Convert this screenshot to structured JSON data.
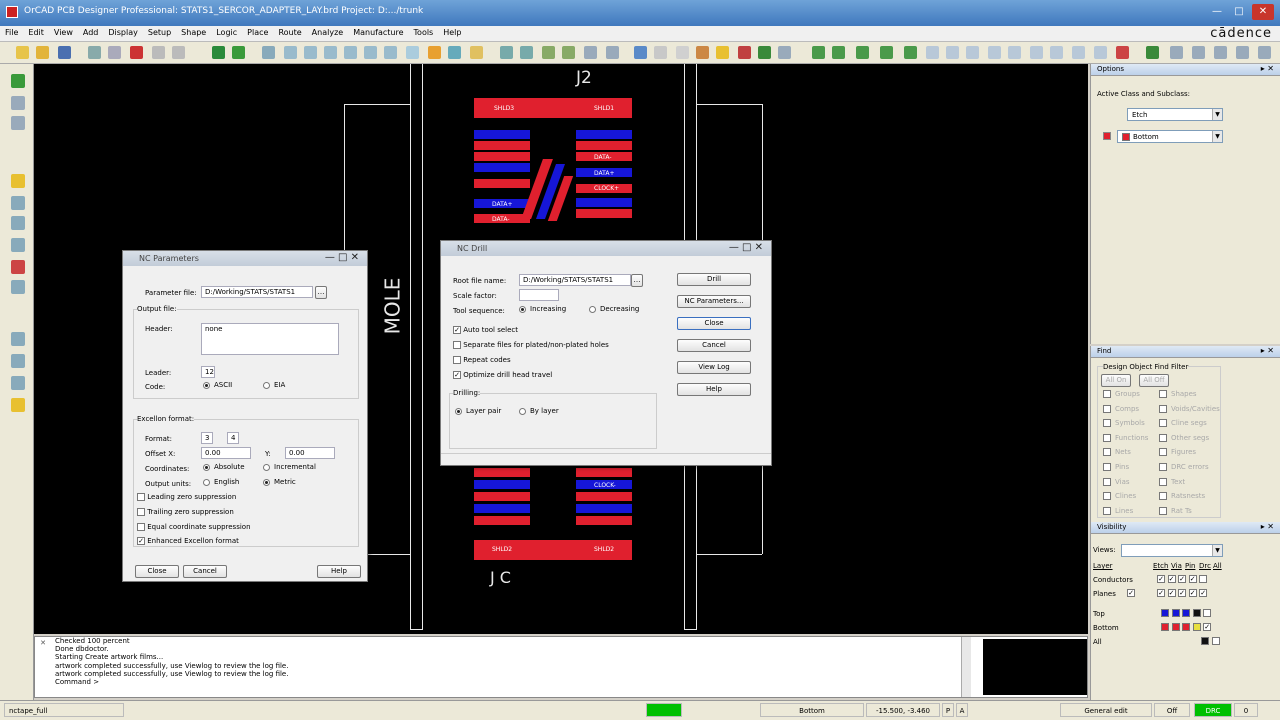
{
  "window": {
    "title": "OrCAD PCB Designer Professional: STATS1_SERCOR_ADAPTER_LAY.brd  Project: D:.../trunk"
  },
  "menu": [
    "File",
    "Edit",
    "View",
    "Add",
    "Display",
    "Setup",
    "Shape",
    "Logic",
    "Place",
    "Route",
    "Analyze",
    "Manufacture",
    "Tools",
    "Help"
  ],
  "brand": "cādence",
  "canvas": {
    "refdes_top": "J2",
    "refdes_side": "MOLE",
    "refdes_bottom": "J C",
    "pads_top": {
      "shld_left": "SHLD3",
      "shld_right": "SHLD1",
      "data_minus": "DATA-",
      "data_plus": "DATA+",
      "clock_plus": "CLOCK+",
      "data_plus_l": "DATA+",
      "data_minus_l": "DATA-"
    },
    "pads_bottom": {
      "clock_minus": "CLOCK-",
      "shld_left": "SHLD2",
      "shld_right": "SHLD2"
    }
  },
  "options_panel": {
    "title": "Options",
    "active_label": "Active Class and Subclass:",
    "class_value": "Etch",
    "subclass_value": "Bottom"
  },
  "find_panel": {
    "title": "Find",
    "group": "Design Object Find Filter",
    "all_on": "All On",
    "all_off": "All Off",
    "left": [
      "Groups",
      "Comps",
      "Symbols",
      "Functions",
      "Nets",
      "Pins",
      "Vias",
      "Clines",
      "Lines"
    ],
    "right": [
      "Shapes",
      "Voids/Cavities",
      "Cline segs",
      "Other segs",
      "Figures",
      "DRC errors",
      "Text",
      "Ratsnests",
      "Rat Ts"
    ]
  },
  "visibility_panel": {
    "title": "Visibility",
    "views_label": "Views:",
    "layer_label": "Layer",
    "cols": [
      "Etch",
      "Via",
      "Pin",
      "Drc",
      "All"
    ],
    "rows": [
      "Conductors",
      "Planes"
    ],
    "layers": [
      "Top",
      "Bottom",
      "All"
    ]
  },
  "nc_params": {
    "title": "NC Parameters",
    "param_file_label": "Parameter file:",
    "param_file": "D:/Working/STATS/STATS1",
    "output_file": "Output file:",
    "header_label": "Header:",
    "header_value": "none",
    "leader_label": "Leader:",
    "leader_value": "12",
    "code_label": "Code:",
    "ascii": "ASCII",
    "eia": "EIA",
    "excellon": "Excellon format:",
    "format_label": "Format:",
    "format_a": "3",
    "format_b": "4",
    "offset_label": "Offset X:",
    "offset_x": "0.00",
    "y_label": "Y:",
    "offset_y": "0.00",
    "coords_label": "Coordinates:",
    "absolute": "Absolute",
    "incremental": "Incremental",
    "units_label": "Output units:",
    "english": "English",
    "metric": "Metric",
    "leading": "Leading zero suppression",
    "trailing": "Trailing zero suppression",
    "equal": "Equal coordinate suppression",
    "enhanced": "Enhanced Excellon format",
    "close": "Close",
    "cancel": "Cancel",
    "help": "Help"
  },
  "nc_drill": {
    "title": "NC Drill",
    "root_label": "Root file name:",
    "root_value": "D:/Working/STATS/STATS1",
    "scale_label": "Scale factor:",
    "seq_label": "Tool sequence:",
    "increasing": "Increasing",
    "decreasing": "Decreasing",
    "auto_tool": "Auto tool select",
    "separate": "Separate files for plated/non-plated holes",
    "repeat": "Repeat codes",
    "optimize": "Optimize drill head travel",
    "drilling": "Drilling:",
    "layer_pair": "Layer pair",
    "by_layer": "By layer",
    "drill": "Drill",
    "nc_params": "NC Parameters...",
    "close": "Close",
    "cancel": "Cancel",
    "view_log": "View Log",
    "help": "Help"
  },
  "console": [
    "Checked 100 percent",
    "Done dbdoctor.",
    "Starting Create artwork films...",
    "artwork completed successfully, use Viewlog to review the log file.",
    "artwork completed successfully, use Viewlog to review the log file.",
    "Command >"
  ],
  "status": {
    "cmd": "nctape_full",
    "layer": "Bottom",
    "coords": "-15.500, -3.460",
    "p": "P",
    "a": "A",
    "mode": "General edit",
    "off": "Off",
    "drc": "DRC",
    "count": "0"
  },
  "colors": {
    "accent_green": "#00c000",
    "pad_red": "#e0202e",
    "pad_blue": "#1616d8"
  }
}
